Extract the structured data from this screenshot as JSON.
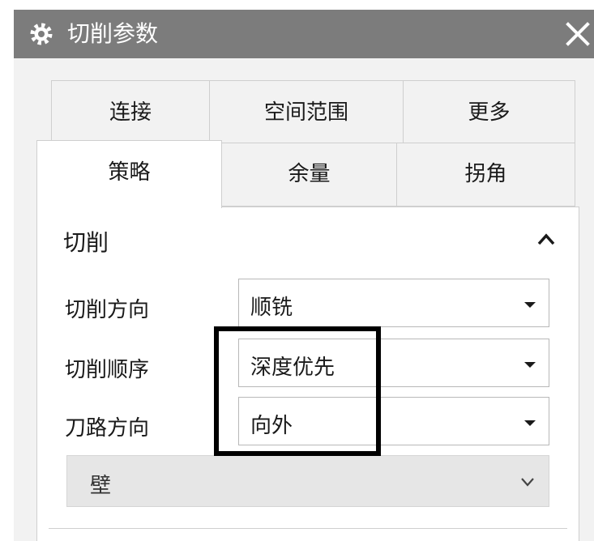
{
  "dialog": {
    "title": "切削参数",
    "icon": "gear-icon",
    "close_icon": "close-icon"
  },
  "tabs": {
    "row1": [
      {
        "label": "连接"
      },
      {
        "label": "空间范围"
      },
      {
        "label": "更多"
      }
    ],
    "row2": [
      {
        "label": "策略",
        "active": true
      },
      {
        "label": "余量"
      },
      {
        "label": "拐角"
      }
    ]
  },
  "group": {
    "title": "切削",
    "toggle_icon": "chevron-up-icon",
    "fields": [
      {
        "label": "切削方向",
        "value": "顺铣"
      },
      {
        "label": "切削顺序",
        "value": "深度优先"
      },
      {
        "label": "刀路方向",
        "value": "向外"
      }
    ]
  },
  "wall_section": {
    "title": "壁",
    "toggle_icon": "chevron-down-icon"
  },
  "colors": {
    "titlebar": "#7c7c7c",
    "dialog_bg": "#f2f2f2",
    "highlight": "#000000"
  }
}
